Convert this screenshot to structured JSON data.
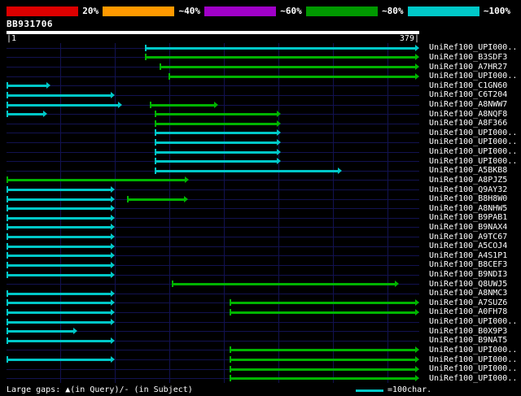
{
  "colors": {
    "background": "#000000",
    "text": "#ffffff",
    "grid": "#121250",
    "row_line": "#121250",
    "query_bar": "#ffffff",
    "cyan": "#00c8c8",
    "green": "#00b400"
  },
  "key": {
    "segments": [
      {
        "color": "#dd0000",
        "label": "20%"
      },
      {
        "color": "#ff9900",
        "label": "~40%"
      },
      {
        "color": "#a000c8",
        "label": "~60%"
      },
      {
        "color": "#009900",
        "label": "~80%"
      },
      {
        "color": "#00c8c8",
        "label": "~100%"
      }
    ]
  },
  "query": {
    "name": "BB931706",
    "length": 379
  },
  "scale": {
    "left": "|1",
    "right": "379|"
  },
  "footer": {
    "left": "Large gaps: ▲(in Query)/- (in Subject)",
    "legend_label": "=100char."
  },
  "chart_data": {
    "type": "alignment-overview",
    "title": "BB931706",
    "query": {
      "name": "BB931706",
      "length": 379,
      "scale_start": 1,
      "scale_end": 379
    },
    "gridline_interval": 50,
    "identity_key": [
      "20%",
      "~40%",
      "~60%",
      "~80%",
      "~100%"
    ],
    "legend": {
      "line_color": "cyan",
      "label": "=100char."
    },
    "rows": [
      {
        "label": "UniRef100_UPI000..",
        "hits": [
          {
            "start": 128,
            "end": 379,
            "color": "cyan"
          }
        ]
      },
      {
        "label": "UniRef100_B3SDF3",
        "hits": [
          {
            "start": 128,
            "end": 379,
            "color": "green"
          }
        ]
      },
      {
        "label": "UniRef100_A7HR27",
        "hits": [
          {
            "start": 141,
            "end": 379,
            "color": "green"
          }
        ]
      },
      {
        "label": "UniRef100_UPI000..",
        "hits": [
          {
            "start": 149,
            "end": 379,
            "color": "green"
          }
        ]
      },
      {
        "label": "UniRef100_C1GN60",
        "hits": [
          {
            "start": 1,
            "end": 41,
            "color": "cyan"
          }
        ]
      },
      {
        "label": "UniRef100_C6T204",
        "hits": [
          {
            "start": 1,
            "end": 100,
            "color": "cyan"
          }
        ]
      },
      {
        "label": "UniRef100_A8NWW7",
        "hits": [
          {
            "start": 1,
            "end": 107,
            "color": "cyan"
          },
          {
            "start": 132,
            "end": 195,
            "color": "green"
          }
        ]
      },
      {
        "label": "UniRef100_A8NQF8",
        "hits": [
          {
            "start": 1,
            "end": 38,
            "color": "cyan"
          },
          {
            "start": 137,
            "end": 252,
            "color": "green"
          }
        ]
      },
      {
        "label": "UniRef100_A8F366",
        "hits": [
          {
            "start": 137,
            "end": 252,
            "color": "green"
          }
        ]
      },
      {
        "label": "UniRef100_UPI000..",
        "hits": [
          {
            "start": 137,
            "end": 252,
            "color": "cyan"
          }
        ]
      },
      {
        "label": "UniRef100_UPI000..",
        "hits": [
          {
            "start": 137,
            "end": 252,
            "color": "cyan"
          }
        ]
      },
      {
        "label": "UniRef100_UPI000..",
        "hits": [
          {
            "start": 137,
            "end": 252,
            "color": "cyan"
          }
        ]
      },
      {
        "label": "UniRef100_UPI000..",
        "hits": [
          {
            "start": 137,
            "end": 252,
            "color": "cyan"
          }
        ]
      },
      {
        "label": "UniRef100_A5BKB8",
        "hits": [
          {
            "start": 137,
            "end": 308,
            "color": "cyan"
          }
        ]
      },
      {
        "label": "UniRef100_A8PJZ5",
        "hits": [
          {
            "start": 1,
            "end": 168,
            "color": "green"
          }
        ]
      },
      {
        "label": "UniRef100_Q9AY32",
        "hits": [
          {
            "start": 1,
            "end": 100,
            "color": "cyan"
          }
        ]
      },
      {
        "label": "UniRef100_B8H8W0",
        "hits": [
          {
            "start": 1,
            "end": 100,
            "color": "cyan"
          },
          {
            "start": 111,
            "end": 167,
            "color": "green"
          }
        ]
      },
      {
        "label": "UniRef100_A8NHW5",
        "hits": [
          {
            "start": 1,
            "end": 100,
            "color": "cyan"
          }
        ]
      },
      {
        "label": "UniRef100_B9PAB1",
        "hits": [
          {
            "start": 1,
            "end": 100,
            "color": "cyan"
          }
        ]
      },
      {
        "label": "UniRef100_B9NAX4",
        "hits": [
          {
            "start": 1,
            "end": 100,
            "color": "cyan"
          }
        ]
      },
      {
        "label": "UniRef100_A9TC67",
        "hits": [
          {
            "start": 1,
            "end": 100,
            "color": "cyan"
          }
        ]
      },
      {
        "label": "UniRef100_A5COJ4",
        "hits": [
          {
            "start": 1,
            "end": 100,
            "color": "cyan"
          }
        ]
      },
      {
        "label": "UniRef100_A4S1P1",
        "hits": [
          {
            "start": 1,
            "end": 100,
            "color": "cyan"
          }
        ]
      },
      {
        "label": "UniRef100_B8CEF3",
        "hits": [
          {
            "start": 1,
            "end": 100,
            "color": "cyan"
          }
        ]
      },
      {
        "label": "UniRef100_B9NDI3",
        "hits": [
          {
            "start": 1,
            "end": 100,
            "color": "cyan"
          }
        ]
      },
      {
        "label": "UniRef100_Q8UWJ5",
        "hits": [
          {
            "start": 152,
            "end": 360,
            "color": "green"
          }
        ]
      },
      {
        "label": "UniRef100_A8NMC3",
        "hits": [
          {
            "start": 1,
            "end": 100,
            "color": "cyan"
          }
        ]
      },
      {
        "label": "UniRef100_A7SUZ6",
        "hits": [
          {
            "start": 1,
            "end": 100,
            "color": "cyan"
          },
          {
            "start": 205,
            "end": 379,
            "color": "green"
          }
        ]
      },
      {
        "label": "UniRef100_A0FH78",
        "hits": [
          {
            "start": 1,
            "end": 100,
            "color": "cyan"
          },
          {
            "start": 205,
            "end": 379,
            "color": "green"
          }
        ]
      },
      {
        "label": "UniRef100_UPI000..",
        "hits": [
          {
            "start": 1,
            "end": 100,
            "color": "cyan"
          }
        ]
      },
      {
        "label": "UniRef100_B0X9P3",
        "hits": [
          {
            "start": 1,
            "end": 66,
            "color": "cyan"
          }
        ]
      },
      {
        "label": "UniRef100_B9NAT5",
        "hits": [
          {
            "start": 1,
            "end": 100,
            "color": "cyan"
          }
        ]
      },
      {
        "label": "UniRef100_UPI000..",
        "hits": [
          {
            "start": 205,
            "end": 379,
            "color": "green"
          }
        ]
      },
      {
        "label": "UniRef100_UPI000..",
        "hits": [
          {
            "start": 1,
            "end": 100,
            "color": "cyan"
          },
          {
            "start": 205,
            "end": 379,
            "color": "green"
          }
        ]
      },
      {
        "label": "UniRef100_UPI000..",
        "hits": [
          {
            "start": 205,
            "end": 379,
            "color": "green"
          }
        ]
      },
      {
        "label": "UniRef100_UPI000..",
        "hits": [
          {
            "start": 205,
            "end": 379,
            "color": "green"
          }
        ]
      }
    ]
  }
}
